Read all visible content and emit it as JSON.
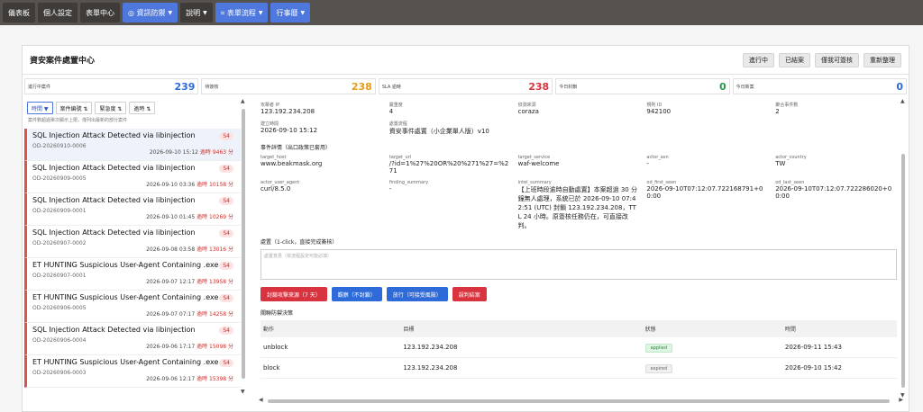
{
  "topnav": [
    {
      "label": "儀表板",
      "blue": false,
      "caret": false
    },
    {
      "label": "個人設定",
      "blue": false,
      "caret": false
    },
    {
      "label": "表單中心",
      "blue": false,
      "caret": false
    },
    {
      "label": "◎ 資訊防禦",
      "blue": true,
      "caret": true
    },
    {
      "label": "說明",
      "blue": false,
      "caret": true
    },
    {
      "label": "⌗ 表單流程",
      "blue": true,
      "caret": true
    },
    {
      "label": "行事曆",
      "blue": true,
      "caret": true
    }
  ],
  "header": {
    "title": "資安案件處置中心",
    "buttons": [
      "進行中",
      "已結案",
      "僅我可簽核",
      "重新整理"
    ]
  },
  "stats": [
    {
      "label": "進行中案件",
      "value": "239",
      "color": "#2f6bd8"
    },
    {
      "label": "待簽核",
      "value": "238",
      "color": "#e69a17"
    },
    {
      "label": "SLA 逾時",
      "value": "238",
      "color": "#d9333f"
    },
    {
      "label": "今日封鎖",
      "value": "0",
      "color": "#2a9a4a"
    },
    {
      "label": "今日新案",
      "value": "0",
      "color": "#2f6bd8"
    }
  ],
  "filters": [
    "時間 ▼",
    "案件編號 ⇅",
    "緊急度 ⇅",
    "逾時 ⇅"
  ],
  "hint": "案件數超過單次顯示上限，僅列出最新的部分案件",
  "cases": [
    {
      "title": "SQL Injection Attack Detected via libinjection",
      "id": "OD-20260910-0006",
      "sev": "S4",
      "time": "2026-09-10 15:12",
      "overdue": "逾時 9463 分"
    },
    {
      "title": "SQL Injection Attack Detected via libinjection",
      "id": "OD-20260909-0005",
      "sev": "S4",
      "time": "2026-09-10 03:36",
      "overdue": "逾時 10158 分"
    },
    {
      "title": "SQL Injection Attack Detected via libinjection",
      "id": "OD-20260909-0001",
      "sev": "S4",
      "time": "2026-09-10 01:45",
      "overdue": "逾時 10269 分"
    },
    {
      "title": "SQL Injection Attack Detected via libinjection",
      "id": "OD-20260907-0002",
      "sev": "S4",
      "time": "2026-09-08 03:58",
      "overdue": "逾時 13016 分"
    },
    {
      "title": "ET HUNTING Suspicious User-Agent Containing .exe",
      "id": "OD-20260907-0001",
      "sev": "S4",
      "time": "2026-09-07 12:17",
      "overdue": "逾時 13958 分"
    },
    {
      "title": "ET HUNTING Suspicious User-Agent Containing .exe",
      "id": "OD-20260906-0005",
      "sev": "S4",
      "time": "2026-09-07 07:17",
      "overdue": "逾時 14258 分"
    },
    {
      "title": "SQL Injection Attack Detected via libinjection",
      "id": "OD-20260906-0004",
      "sev": "S4",
      "time": "2026-09-06 17:17",
      "overdue": "逾時 15098 分"
    },
    {
      "title": "ET HUNTING Suspicious User-Agent Containing .exe",
      "id": "OD-20260906-0003",
      "sev": "S4",
      "time": "2026-09-06 12:17",
      "overdue": "逾時 15398 分"
    }
  ],
  "detail": {
    "fields1": [
      {
        "label": "攻擊者 IP",
        "value": "123.192.234.208"
      },
      {
        "label": "嚴重度",
        "value": "4"
      },
      {
        "label": "偵測來源",
        "value": "coraza"
      },
      {
        "label": "規則 ID",
        "value": "942100"
      },
      {
        "label": "聚合事件數",
        "value": "2"
      }
    ],
    "fields2": [
      {
        "label": "建立時間",
        "value": "2026-09-10 15:12"
      },
      {
        "label": "處置流程",
        "value": "資安事件處置（小企業單人版）v10"
      }
    ],
    "event_section": "事件詳情（出口政策已套用）",
    "fields3": [
      {
        "label": "target_host",
        "value": "www.beakmask.org"
      },
      {
        "label": "target_url",
        "value": "/?id=1%27%20OR%20%271%27=%271"
      },
      {
        "label": "target_service",
        "value": "waf-welcome"
      },
      {
        "label": "actor_asn",
        "value": "-"
      },
      {
        "label": "actor_country",
        "value": "TW"
      }
    ],
    "fields4": [
      {
        "label": "actor_user_agent",
        "value": "curl/8.5.0"
      },
      {
        "label": "finding_summary",
        "value": "-"
      },
      {
        "label": "intel_summary",
        "value": "【上班時段逾時自動處置】本案超過 30 分鐘無人處理，系統已於 2026-09-10 07:42:51 (UTC) 封鎖 123.192.234.208，TTL 24 小時。原簽核任務仍在，可直接改判。"
      },
      {
        "label": "od_first_seen",
        "value": "2026-09-10T07:12:07.722168791+00:00"
      },
      {
        "label": "od_last_seen",
        "value": "2026-09-10T07:12:07.722286020+00:00"
      }
    ],
    "disposition_label": "處置（1-click，直接完成簽核）",
    "textarea_placeholder": "處置意見（依流程設定可能必填）",
    "actions": [
      {
        "label": "封鎖攻擊來源（7 天）",
        "color": "#d9333f"
      },
      {
        "label": "觀察（不封鎖）",
        "color": "#2f6bd8"
      },
      {
        "label": "放行（可接受風險）",
        "color": "#2f6bd8"
      },
      {
        "label": "誤判結案",
        "color": "#d9333f"
      }
    ],
    "defense_title": "關聯防禦決策",
    "columns": [
      "動作",
      "目標",
      "狀態",
      "時間"
    ],
    "rows": [
      {
        "action": "unblock",
        "target": "123.192.234.208",
        "status": "applied",
        "time": "2026-09-11 15:43"
      },
      {
        "action": "block",
        "target": "123.192.234.208",
        "status": "expired",
        "time": "2026-09-10 15:42"
      }
    ]
  }
}
